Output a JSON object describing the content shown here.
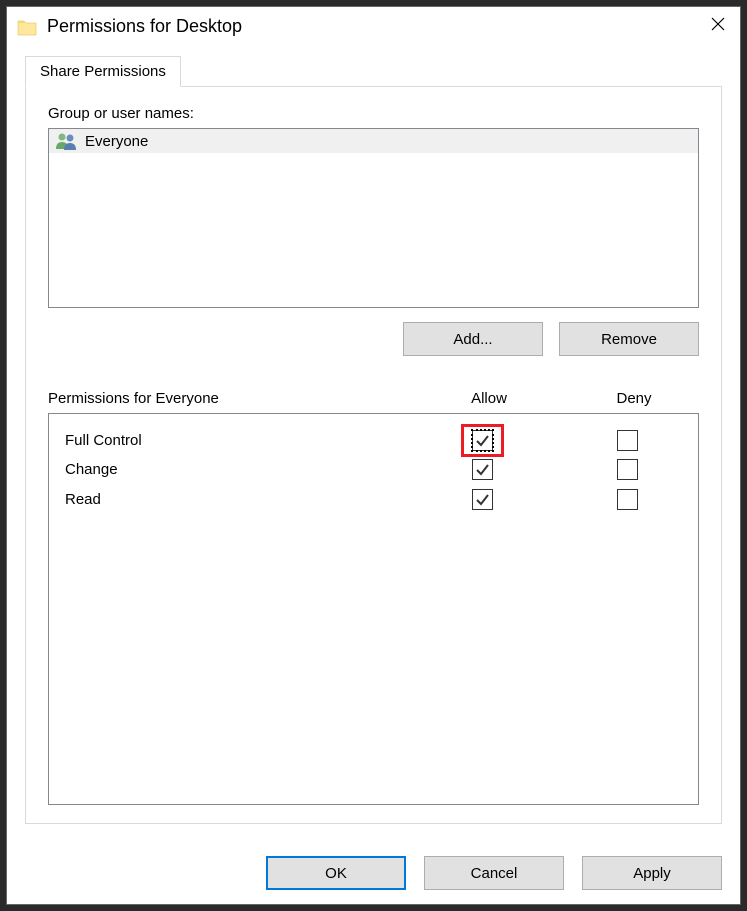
{
  "dialog": {
    "title": "Permissions for Desktop"
  },
  "tabs": {
    "share": "Share Permissions"
  },
  "section": {
    "groupLabel": "Group or user names:",
    "permLabel": "Permissions for Everyone"
  },
  "users": [
    {
      "name": "Everyone"
    }
  ],
  "buttons": {
    "add": "Add...",
    "remove": "Remove",
    "ok": "OK",
    "cancel": "Cancel",
    "apply": "Apply"
  },
  "columns": {
    "allow": "Allow",
    "deny": "Deny"
  },
  "permissions": [
    {
      "name": "Full Control",
      "allow": true,
      "deny": false,
      "focused": true,
      "highlight": true
    },
    {
      "name": "Change",
      "allow": true,
      "deny": false
    },
    {
      "name": "Read",
      "allow": true,
      "deny": false
    }
  ]
}
